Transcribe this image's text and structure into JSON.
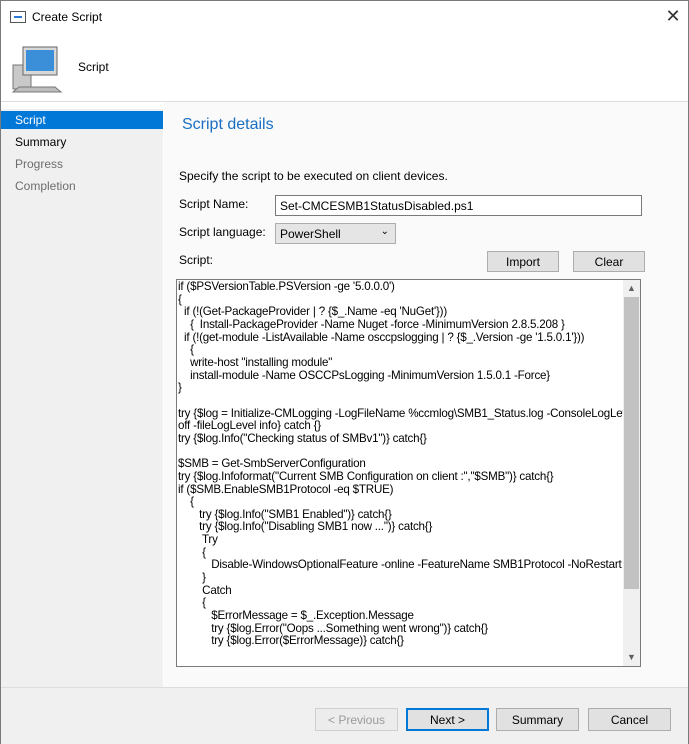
{
  "window": {
    "title": "Create Script",
    "close_icon": "close-icon"
  },
  "header": {
    "title": "Script",
    "icon": "computer-icon"
  },
  "sidebar": {
    "items": [
      {
        "label": "Script",
        "selected": true
      },
      {
        "label": "Summary"
      },
      {
        "label": "Progress"
      },
      {
        "label": "Completion"
      }
    ]
  },
  "main": {
    "section_title": "Script details",
    "description": "Specify the script to be executed on client devices.",
    "script_name_label": "Script Name:",
    "script_name_value": "Set-CMCESMB1StatusDisabled.ps1",
    "language_label": "Script language:",
    "language_value": "PowerShell",
    "script_label": "Script:",
    "import_label": "Import",
    "clear_label": "Clear",
    "script_text": "if ($PSVersionTable.PSVersion -ge '5.0.0.0')\n{\n  if (!(Get-PackageProvider | ? {$_.Name -eq 'NuGet'}))\n    {  Install-PackageProvider -Name Nuget -force -MinimumVersion 2.8.5.208 }\n  if (!(get-module -ListAvailable -Name osccpslogging | ? {$_.Version -ge '1.5.0.1'}))\n    {\n    write-host \"installing module\"\n    install-module -Name OSCCPsLogging -MinimumVersion 1.5.0.1 -Force}\n}\n\ntry {$log = Initialize-CMLogging -LogFileName %ccmlog\\SMB1_Status.log -ConsoleLogLevel\noff -fileLogLevel info} catch {}\ntry {$log.Info(\"Checking status of SMBv1\")} catch{}\n\n$SMB = Get-SmbServerConfiguration\ntry {$log.Infoformat(\"Current SMB Configuration on client :\",\"$SMB\")} catch{}\nif ($SMB.EnableSMB1Protocol -eq $TRUE)\n    {\n       try {$log.Info(\"SMB1 Enabled\")} catch{}\n       try {$log.Info(\"Disabling SMB1 now ...\")} catch{}\n        Try\n        {\n           Disable-WindowsOptionalFeature -online -FeatureName SMB1Protocol -NoRestart\n        }\n        Catch\n        {\n           $ErrorMessage = $_.Exception.Message\n           try {$log.Error(\"Oops ...Something went wrong\")} catch{}\n           try {$log.Error($ErrorMessage)} catch{}"
  },
  "footer": {
    "previous_label": "< Previous",
    "next_label": "Next >",
    "summary_label": "Summary",
    "cancel_label": "Cancel"
  },
  "colors": {
    "accent": "#0078d7",
    "section_title": "#1a6fc4"
  }
}
